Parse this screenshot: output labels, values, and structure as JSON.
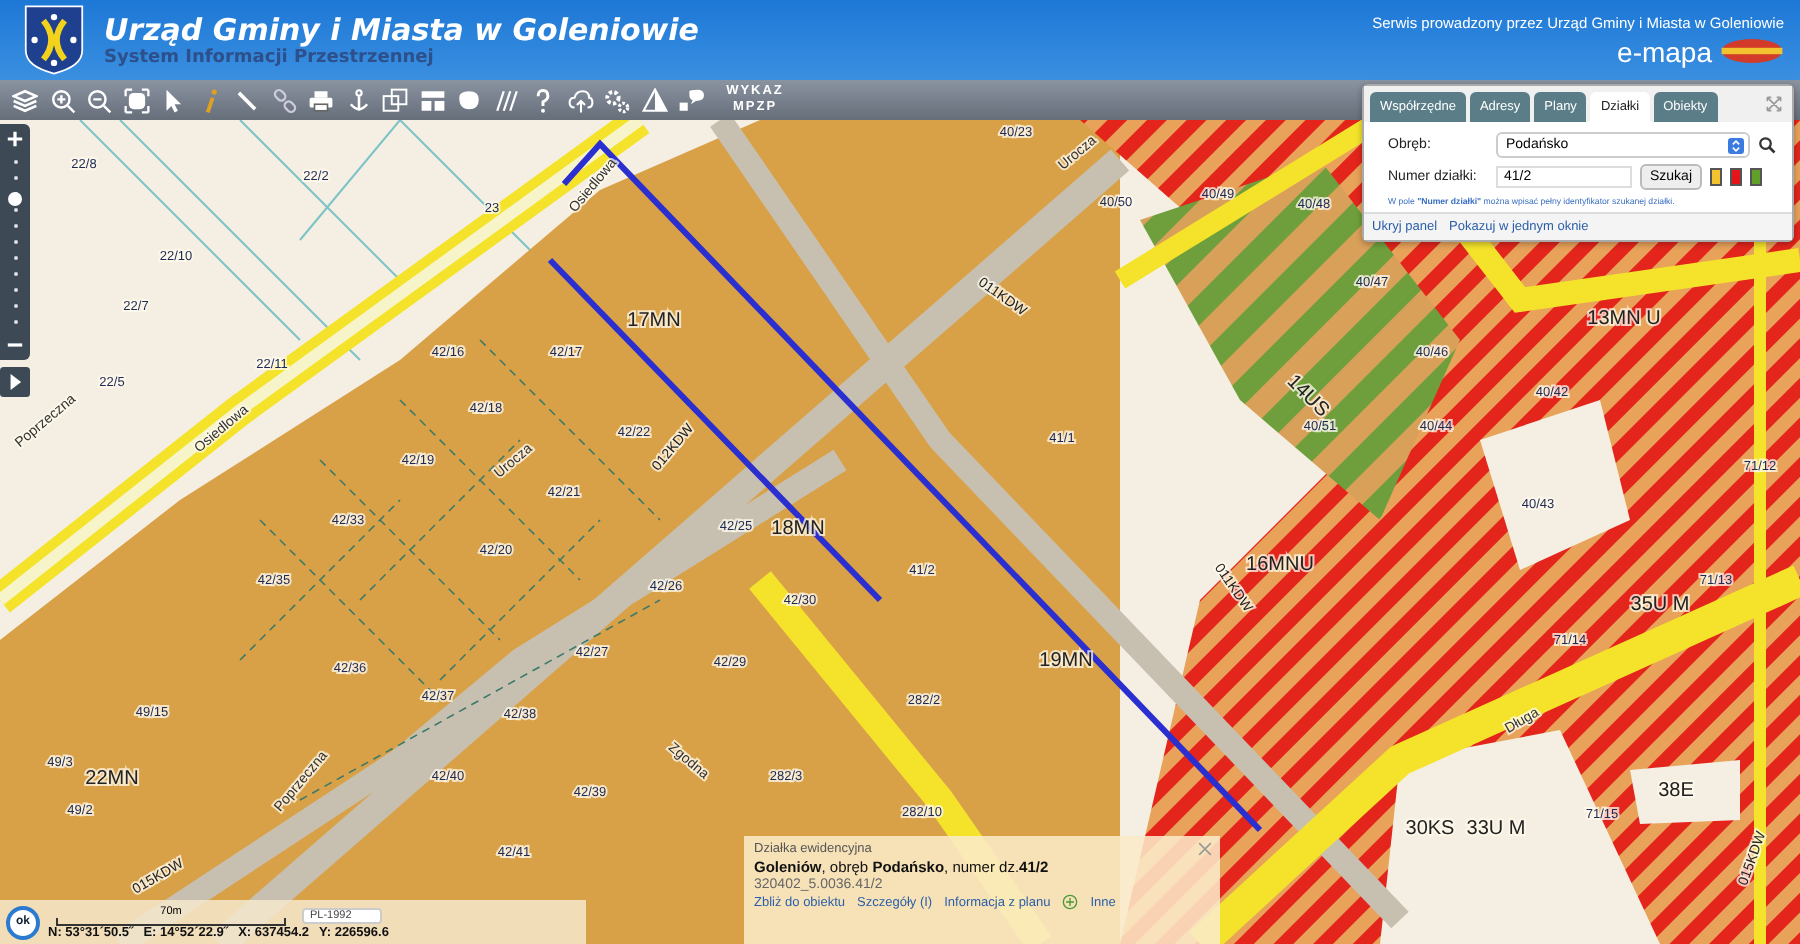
{
  "header": {
    "title": "Urząd Gminy i Miasta w Goleniowie",
    "subtitle": "System Informacji Przestrzennej",
    "service_note": "Serwis prowadzony przez Urząd Gminy i Miasta w Goleniowie",
    "brand": "e-mapa"
  },
  "toolbar": {
    "text_button": "WYKAZ MPZP"
  },
  "zoom_slider": {
    "level": 0.75
  },
  "map_labels": [
    {
      "text": "22/8",
      "kind": "parcel"
    },
    {
      "text": "22/2",
      "kind": "parcel"
    },
    {
      "text": "23",
      "kind": "parcel"
    },
    {
      "text": "22/10",
      "kind": "parcel"
    },
    {
      "text": "22/7",
      "kind": "parcel"
    },
    {
      "text": "22/11",
      "kind": "parcel"
    },
    {
      "text": "22/5",
      "kind": "parcel"
    },
    {
      "text": "Osiedlowa",
      "kind": "street"
    },
    {
      "text": "Osiedlowa",
      "kind": "street"
    },
    {
      "text": "Poprzeczna",
      "kind": "street"
    },
    {
      "text": "17MN",
      "kind": "zone"
    },
    {
      "text": "42/16",
      "kind": "parcel"
    },
    {
      "text": "42/17",
      "kind": "parcel"
    },
    {
      "text": "42/18",
      "kind": "parcel"
    },
    {
      "text": "42/22",
      "kind": "parcel"
    },
    {
      "text": "42/19",
      "kind": "parcel"
    },
    {
      "text": "42/21",
      "kind": "parcel"
    },
    {
      "text": "Urocza",
      "kind": "street"
    },
    {
      "text": "012KDW",
      "kind": "road"
    },
    {
      "text": "42/33",
      "kind": "parcel"
    },
    {
      "text": "42/20",
      "kind": "parcel"
    },
    {
      "text": "42/25",
      "kind": "parcel"
    },
    {
      "text": "18MN",
      "kind": "zone"
    },
    {
      "text": "42/35",
      "kind": "parcel"
    },
    {
      "text": "42/26",
      "kind": "parcel"
    },
    {
      "text": "42/30",
      "kind": "parcel"
    },
    {
      "text": "41/2",
      "kind": "parcel"
    },
    {
      "text": "41/1",
      "kind": "parcel"
    },
    {
      "text": "011KDW",
      "kind": "road"
    },
    {
      "text": "42/36",
      "kind": "parcel"
    },
    {
      "text": "42/27",
      "kind": "parcel"
    },
    {
      "text": "42/29",
      "kind": "parcel"
    },
    {
      "text": "42/37",
      "kind": "parcel"
    },
    {
      "text": "42/38",
      "kind": "parcel"
    },
    {
      "text": "49/15",
      "kind": "parcel"
    },
    {
      "text": "19MN",
      "kind": "zone"
    },
    {
      "text": "011KDW",
      "kind": "road"
    },
    {
      "text": "49/3",
      "kind": "parcel"
    },
    {
      "text": "22MN",
      "kind": "zone"
    },
    {
      "text": "42/40",
      "kind": "parcel"
    },
    {
      "text": "42/39",
      "kind": "parcel"
    },
    {
      "text": "49/2",
      "kind": "parcel"
    },
    {
      "text": "Poprzeczna",
      "kind": "street"
    },
    {
      "text": "Zgodna",
      "kind": "street"
    },
    {
      "text": "015KDW",
      "kind": "road"
    },
    {
      "text": "42/41",
      "kind": "parcel"
    },
    {
      "text": "14US",
      "kind": "zone"
    },
    {
      "text": "16MNU",
      "kind": "zone"
    },
    {
      "text": "13MN U",
      "kind": "zone"
    },
    {
      "text": "35U M",
      "kind": "zone"
    },
    {
      "text": "33U M",
      "kind": "zone"
    },
    {
      "text": "30KS",
      "kind": "zone"
    },
    {
      "text": "38E",
      "kind": "zone"
    },
    {
      "text": "Długa",
      "kind": "street"
    },
    {
      "text": "Urocza",
      "kind": "street"
    },
    {
      "text": "40/50",
      "kind": "parcel"
    },
    {
      "text": "40/49",
      "kind": "parcel"
    },
    {
      "text": "40/48",
      "kind": "parcel"
    },
    {
      "text": "40/47",
      "kind": "parcel"
    },
    {
      "text": "40/46",
      "kind": "parcel"
    },
    {
      "text": "40/51",
      "kind": "parcel"
    },
    {
      "text": "40/44",
      "kind": "parcel"
    },
    {
      "text": "40/42",
      "kind": "parcel"
    },
    {
      "text": "71/12",
      "kind": "parcel"
    },
    {
      "text": "71/13",
      "kind": "parcel"
    },
    {
      "text": "71/14",
      "kind": "parcel"
    },
    {
      "text": "71/15",
      "kind": "parcel"
    },
    {
      "text": "40/43",
      "kind": "parcel"
    },
    {
      "text": "40/23",
      "kind": "parcel"
    },
    {
      "text": "282/2",
      "kind": "parcel"
    },
    {
      "text": "282/10",
      "kind": "parcel"
    },
    {
      "text": "282/3",
      "kind": "parcel"
    },
    {
      "text": "015KDW",
      "kind": "road"
    }
  ],
  "search_panel": {
    "tabs": [
      {
        "label": "Współrzędne",
        "selected": false
      },
      {
        "label": "Adresy",
        "selected": false
      },
      {
        "label": "Plany",
        "selected": false
      },
      {
        "label": "Działki",
        "selected": true
      },
      {
        "label": "Obiekty",
        "selected": false
      }
    ],
    "precinct_label": "Obręb:",
    "precinct_value": "Podańsko",
    "parcel_label": "Numer działki:",
    "parcel_value": "41/2",
    "search_button": "Szukaj",
    "swatches": [
      {
        "color": "#f2c230"
      },
      {
        "color": "#e3141a"
      },
      {
        "color": "#5f9f2a"
      }
    ],
    "hint": "W pole **\"Numer działki\"** można wpisać pełny identyfikator szukanej działki.",
    "links": [
      "Ukryj panel",
      "Pokazuj w jednym oknie"
    ]
  },
  "info_popup": {
    "title": "Działka ewidencyjna",
    "description": "**Goleniów**, obręb **Podańsko**, numer dz.**41/2**",
    "identifier": "320402_5.0036.41/2",
    "links": [
      {
        "label": "Zbliż do obiektu",
        "kind": "link"
      },
      {
        "label": "Szczegóły (I)",
        "kind": "link"
      },
      {
        "label": "Informacja z planu",
        "kind": "link"
      },
      {
        "label": "Inne",
        "kind": "plus"
      }
    ]
  },
  "status_bar": {
    "ok_button": "ok",
    "scale": "70m",
    "crs": "PL-1992",
    "coords": [
      "N: 53°31´50.5˝",
      "E: 14°52´22.9˝",
      "X: 637454.2",
      "Y: 226596.6"
    ]
  }
}
